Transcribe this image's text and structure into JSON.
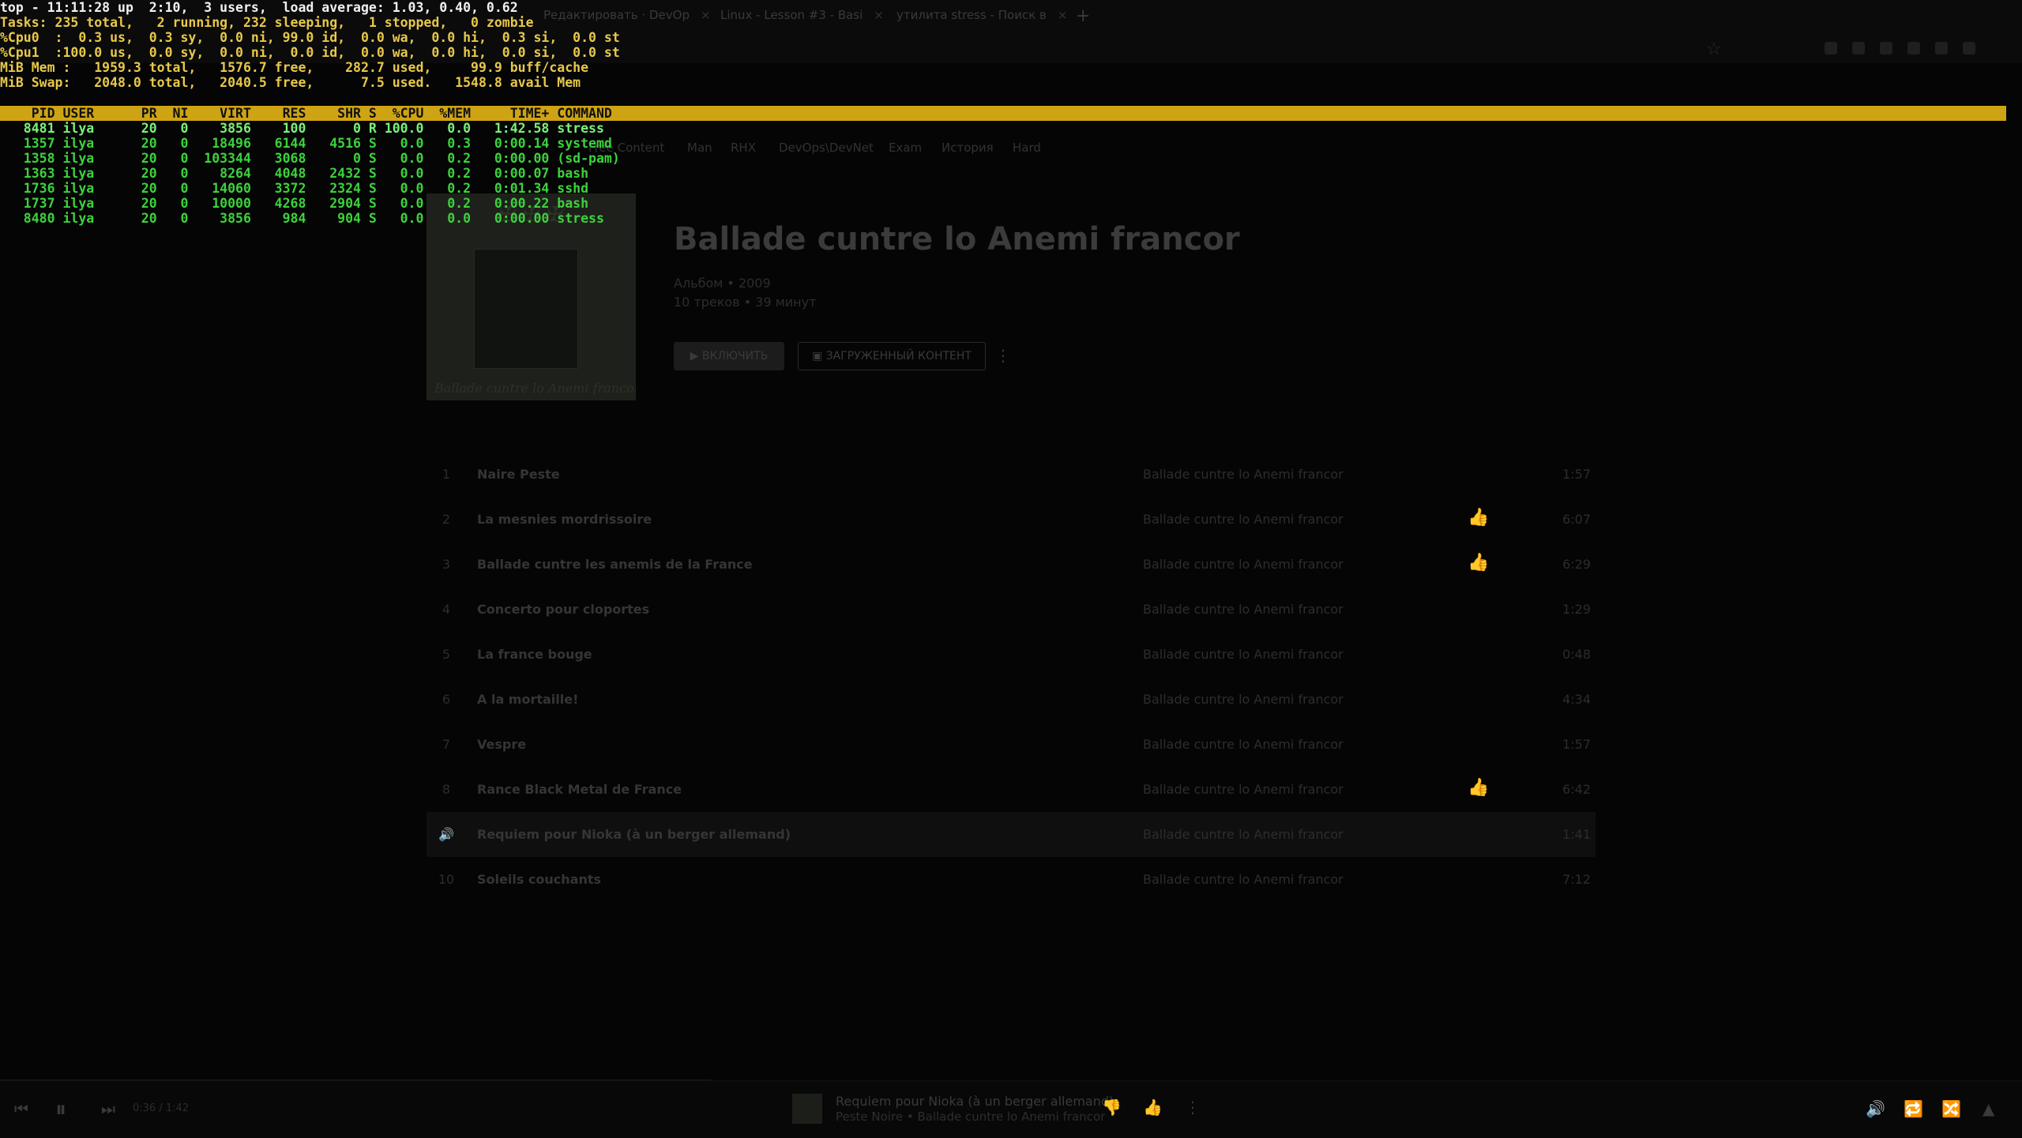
{
  "browser": {
    "tabs": [
      {
        "label": "Редактировать · DevOp",
        "close": "×"
      },
      {
        "label": "Linux - Lesson #3 - Basi",
        "close": "×"
      },
      {
        "label": "утилита stress - Поиск в",
        "close": "×"
      }
    ],
    "new_tab": "+",
    "bookmarks": [
      "Free Content",
      "Man",
      "RHX",
      "DevOps\\DevNet",
      "Exam",
      "История",
      "Hard"
    ]
  },
  "album": {
    "cover_caption": "Ballade cuntre lo Anemi francor",
    "title": "Ballade cuntre lo Anemi francor",
    "meta": "Альбом • 2009",
    "stats": "10 треков • 39 минут",
    "play_label": "ВКЛЮЧИТЬ",
    "downloaded_label": "ЗАГРУЖЕННЫЙ КОНТЕНТ",
    "more": "⋮"
  },
  "tracks": [
    {
      "num": "1",
      "name": "Naire Peste",
      "album": "Ballade cuntre lo Anemi francor",
      "liked": false,
      "duration": "1:57"
    },
    {
      "num": "2",
      "name": "La mesnies mordrissoire",
      "album": "Ballade cuntre lo Anemi francor",
      "liked": true,
      "duration": "6:07"
    },
    {
      "num": "3",
      "name": "Ballade cuntre les anemis de la France",
      "album": "Ballade cuntre lo Anemi francor",
      "liked": true,
      "duration": "6:29"
    },
    {
      "num": "4",
      "name": "Concerto pour cloportes",
      "album": "Ballade cuntre lo Anemi francor",
      "liked": false,
      "duration": "1:29"
    },
    {
      "num": "5",
      "name": "La france bouge",
      "album": "Ballade cuntre lo Anemi francor",
      "liked": false,
      "duration": "0:48"
    },
    {
      "num": "6",
      "name": "A la mortaille!",
      "album": "Ballade cuntre lo Anemi francor",
      "liked": false,
      "duration": "4:34"
    },
    {
      "num": "7",
      "name": "Vespre",
      "album": "Ballade cuntre lo Anemi francor",
      "liked": false,
      "duration": "1:57"
    },
    {
      "num": "8",
      "name": "Rance Black Metal de France",
      "album": "Ballade cuntre lo Anemi francor",
      "liked": true,
      "duration": "6:42"
    },
    {
      "num": "🔊",
      "name": "Requiem pour Nioka (à un berger allemand)",
      "album": "Ballade cuntre lo Anemi francor",
      "liked": false,
      "duration": "1:41",
      "playing": true
    },
    {
      "num": "10",
      "name": "Soleils couchants",
      "album": "Ballade cuntre lo Anemi francor",
      "liked": false,
      "duration": "7:12"
    }
  ],
  "player": {
    "time": "0:36 / 1:42",
    "title": "Requiem pour Nioka (à un berger allemand)",
    "subtitle": "Peste Noire • Ballade cuntre lo Anemi francor"
  },
  "top": {
    "summary": [
      "top - 11:11:28 up  2:10,  3 users,  load average: 1.03, 0.40, 0.62",
      "Tasks: 235 total,   2 running, 232 sleeping,   1 stopped,   0 zombie",
      "%Cpu0  :  0.3 us,  0.3 sy,  0.0 ni, 99.0 id,  0.0 wa,  0.0 hi,  0.3 si,  0.0 st",
      "%Cpu1  :100.0 us,  0.0 sy,  0.0 ni,  0.0 id,  0.0 wa,  0.0 hi,  0.0 si,  0.0 st",
      "MiB Mem :   1959.3 total,   1576.7 free,    282.7 used,     99.9 buff/cache",
      "MiB Swap:   2048.0 total,   2040.5 free,      7.5 used.   1548.8 avail Mem"
    ],
    "header": "    PID USER      PR  NI    VIRT    RES    SHR S  %CPU  %MEM     TIME+ COMMAND",
    "processes": [
      "   8481 ilya      20   0    3856    100      0 R 100.0   0.0   1:42.58 stress",
      "   1357 ilya      20   0   18496   6144   4516 S   0.0   0.3   0:00.14 systemd",
      "   1358 ilya      20   0  103344   3068      0 S   0.0   0.2   0:00.00 (sd-pam)",
      "   1363 ilya      20   0    8264   4048   2432 S   0.0   0.2   0:00.07 bash",
      "   1736 ilya      20   0   14060   3372   2324 S   0.0   0.2   0:01.34 sshd",
      "   1737 ilya      20   0   10000   4268   2904 S   0.0   0.2   0:00.22 bash",
      "   8480 ilya      20   0    3856    984    904 S   0.0   0.0   0:00.00 stress"
    ]
  }
}
